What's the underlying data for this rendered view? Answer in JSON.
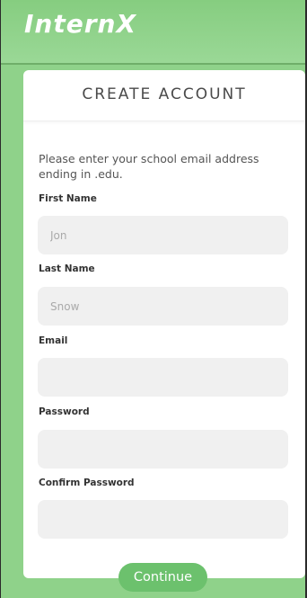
{
  "app": {
    "brand": "InternX"
  },
  "form": {
    "title": "CREATE ACCOUNT",
    "instructions": "Please enter your school email address ending in .edu.",
    "fields": [
      {
        "label": "First Name",
        "value": "",
        "placeholder": "Jon"
      },
      {
        "label": "Last Name",
        "value": "",
        "placeholder": "Snow"
      },
      {
        "label": "Email",
        "value": "",
        "placeholder": ""
      },
      {
        "label": "Password",
        "value": "",
        "placeholder": ""
      },
      {
        "label": "Confirm Password",
        "value": "",
        "placeholder": ""
      }
    ],
    "continue_label": "Continue"
  },
  "colors": {
    "background_green": "#8fd28a",
    "button_green": "#6cc16d",
    "input_gray": "#f0f0f0"
  }
}
